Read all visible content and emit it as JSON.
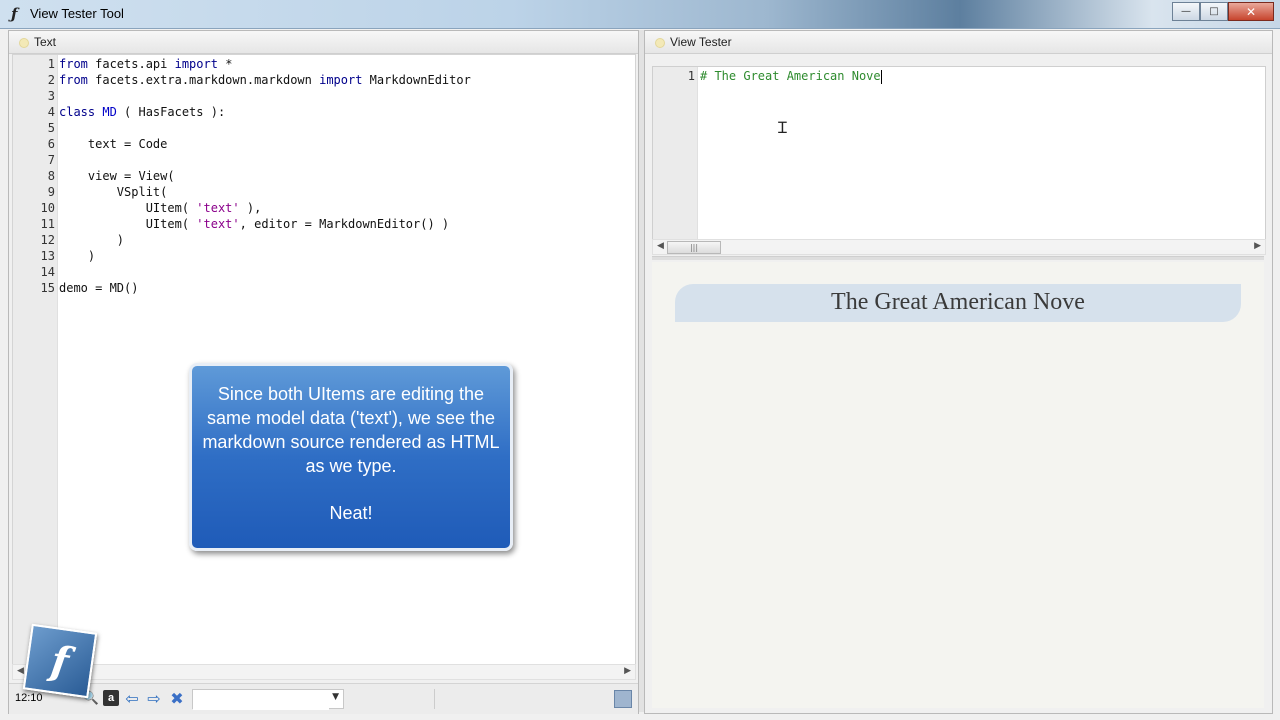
{
  "window": {
    "title": "View Tester Tool",
    "minimize": "—",
    "maximize": "□",
    "close": "✕"
  },
  "left": {
    "tab_label": "Text",
    "code": [
      {
        "n": "1",
        "parts": [
          [
            "kw",
            "from"
          ],
          [
            "t",
            " facets.api "
          ],
          [
            "kw",
            "import"
          ],
          [
            "t",
            " *"
          ]
        ]
      },
      {
        "n": "2",
        "parts": [
          [
            "kw",
            "from"
          ],
          [
            "t",
            " facets.extra.markdown.markdown "
          ],
          [
            "kw",
            "import"
          ],
          [
            "t",
            " MarkdownEditor"
          ]
        ]
      },
      {
        "n": "3",
        "parts": []
      },
      {
        "n": "4",
        "parts": [
          [
            "kw",
            "class"
          ],
          [
            "t",
            " "
          ],
          [
            "cls",
            "MD"
          ],
          [
            "t",
            " ( HasFacets ):"
          ]
        ]
      },
      {
        "n": "5",
        "parts": []
      },
      {
        "n": "6",
        "parts": [
          [
            "t",
            "    text = Code"
          ]
        ]
      },
      {
        "n": "7",
        "parts": []
      },
      {
        "n": "8",
        "parts": [
          [
            "t",
            "    view = View("
          ]
        ]
      },
      {
        "n": "9",
        "parts": [
          [
            "t",
            "        VSplit("
          ]
        ]
      },
      {
        "n": "10",
        "parts": [
          [
            "t",
            "            UItem( "
          ],
          [
            "str",
            "'text'"
          ],
          [
            "t",
            " ),"
          ]
        ]
      },
      {
        "n": "11",
        "parts": [
          [
            "t",
            "            UItem( "
          ],
          [
            "str",
            "'text'"
          ],
          [
            "t",
            ", editor = MarkdownEditor() )"
          ]
        ]
      },
      {
        "n": "12",
        "parts": [
          [
            "t",
            "        )"
          ]
        ]
      },
      {
        "n": "13",
        "parts": [
          [
            "t",
            "    )"
          ]
        ]
      },
      {
        "n": "14",
        "parts": []
      },
      {
        "n": "15",
        "parts": [
          [
            "t",
            "demo = MD()"
          ]
        ]
      }
    ],
    "status": {
      "position": "12:10",
      "find_value": "",
      "aa": "a"
    }
  },
  "callout": {
    "message": "Since both UItems are editing the same model data ('text'), we see the markdown source rendered as HTML as we type.",
    "neat": "Neat!"
  },
  "right": {
    "tab_label": "View Tester",
    "editor_line_number": "1",
    "editor_text": "# The Great American Nove",
    "rendered_heading": "The Great American Nove"
  },
  "logo_letter": "f"
}
